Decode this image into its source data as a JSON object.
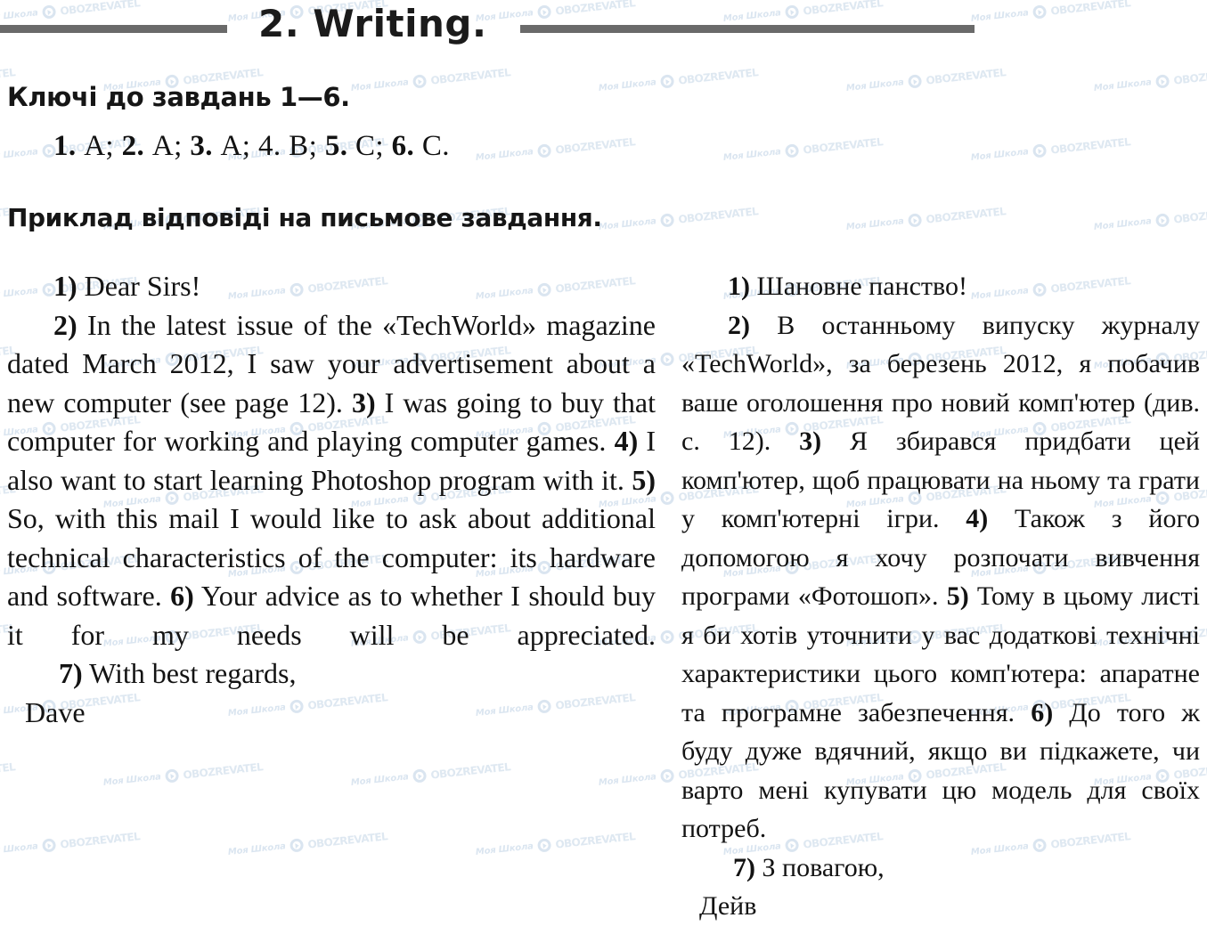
{
  "header": {
    "title": "2. Writing.",
    "rule_color": "#6a6a6a"
  },
  "keys": {
    "heading": "Ключі до завдань 1—6.",
    "answers_line": "1. A; 2. A; 3. A; 4. B; 5. C; 6. C.",
    "items": [
      {
        "number": "1.",
        "answer": "A",
        "bold_number": true
      },
      {
        "number": "2.",
        "answer": "A",
        "bold_number": true
      },
      {
        "number": "3.",
        "answer": "A",
        "bold_number": true
      },
      {
        "number": "4.",
        "answer": "B",
        "bold_number": false
      },
      {
        "number": "5.",
        "answer": "C",
        "bold_number": true
      },
      {
        "number": "6.",
        "answer": "C",
        "bold_number": true
      }
    ]
  },
  "sample": {
    "heading": "Приклад відповіді на письмове завдання."
  },
  "letter_en": {
    "language": "English",
    "greeting": "1) Dear Sirs!",
    "body": "2) In the latest issue of the «TechWorld» magazine dated March 2012, I saw your advertisement about a new computer (see page 12). 3) I was going to buy that computer for working and playing computer games. 4) I also want to start learning Photoshop program with it. 5) So, with this mail I would like to ask about additional technical characteristics of the computer: its hardware and software. 6) Your advice as to whether I should buy it for my needs will be appreciated.",
    "closing": "7) With best regards,",
    "signature": "Dave",
    "segments": [
      {
        "marker": "1)",
        "text": "Dear Sirs!"
      },
      {
        "marker": "2)",
        "text": "In the latest issue of the «TechWorld» magazine dated March 2012, I saw your advertisement about a new computer (see page 12)."
      },
      {
        "marker": "3)",
        "text": "I was going to buy that computer for working and playing computer games."
      },
      {
        "marker": "4)",
        "text": "I also want to start learning Photoshop program with it."
      },
      {
        "marker": "5)",
        "text": "So, with this mail I would like to ask about additional technical characteristics of the computer: its hardware and software."
      },
      {
        "marker": "6)",
        "text": "Your advice as to whether I should buy it for my needs will be appreciated."
      },
      {
        "marker": "7)",
        "text": "With best regards,"
      }
    ]
  },
  "letter_uk": {
    "language": "Ukrainian",
    "greeting": "1) Шановне панство!",
    "body": "2) В останньому випуску журналу «TechWorld», за березень 2012, я побачив ваше оголошення про новий комп'ютер (див. с. 12). 3) Я збирався придбати цей комп'ютер, щоб працювати на ньому та грати у комп'ютерні ігри. 4) Також з його допомогою я хочу розпочати вивчення програми «Фотошоп». 5) Тому в цьому листі я би хотів уточнити у вас додаткові технічні характеристики цього комп'ютера: апаратне та програмне забезпечення. 6) До того ж буду дуже вдячний, якщо ви підкажете, чи варто мені купувати цю модель для своїх потреб.",
    "closing": "7) З повагою,",
    "signature": "Дейв",
    "segments": [
      {
        "marker": "1)",
        "text": "Шановне панство!"
      },
      {
        "marker": "2)",
        "text": "В останньому випуску журналу «TechWorld», за березень 2012, я побачив ваше оголошення про новий комп'ютер (див. с. 12)."
      },
      {
        "marker": "3)",
        "text": "Я збирався придбати цей комп'ютер, щоб працювати на ньому та грати у комп'ютерні ігри."
      },
      {
        "marker": "4)",
        "text": "Також з його допомогою я хочу розпочати вивчення програми «Фотошоп»."
      },
      {
        "marker": "5)",
        "text": "Тому в цьому листі я би хотів уточнити у вас додаткові технічні характеристики цього комп'ютера: апаратне та програмне забезпечення."
      },
      {
        "marker": "6)",
        "text": "До того ж буду дуже вдячний, якщо ви підкажете, чи варто мені купувати цю модель для своїх потреб."
      },
      {
        "marker": "7)",
        "text": "З повагою,"
      }
    ]
  },
  "watermark": {
    "school_text": "Моя Школа",
    "brand_text": "OBOZREVATEL",
    "icon": "play-circle-icon",
    "color": "#c5d6e8"
  }
}
